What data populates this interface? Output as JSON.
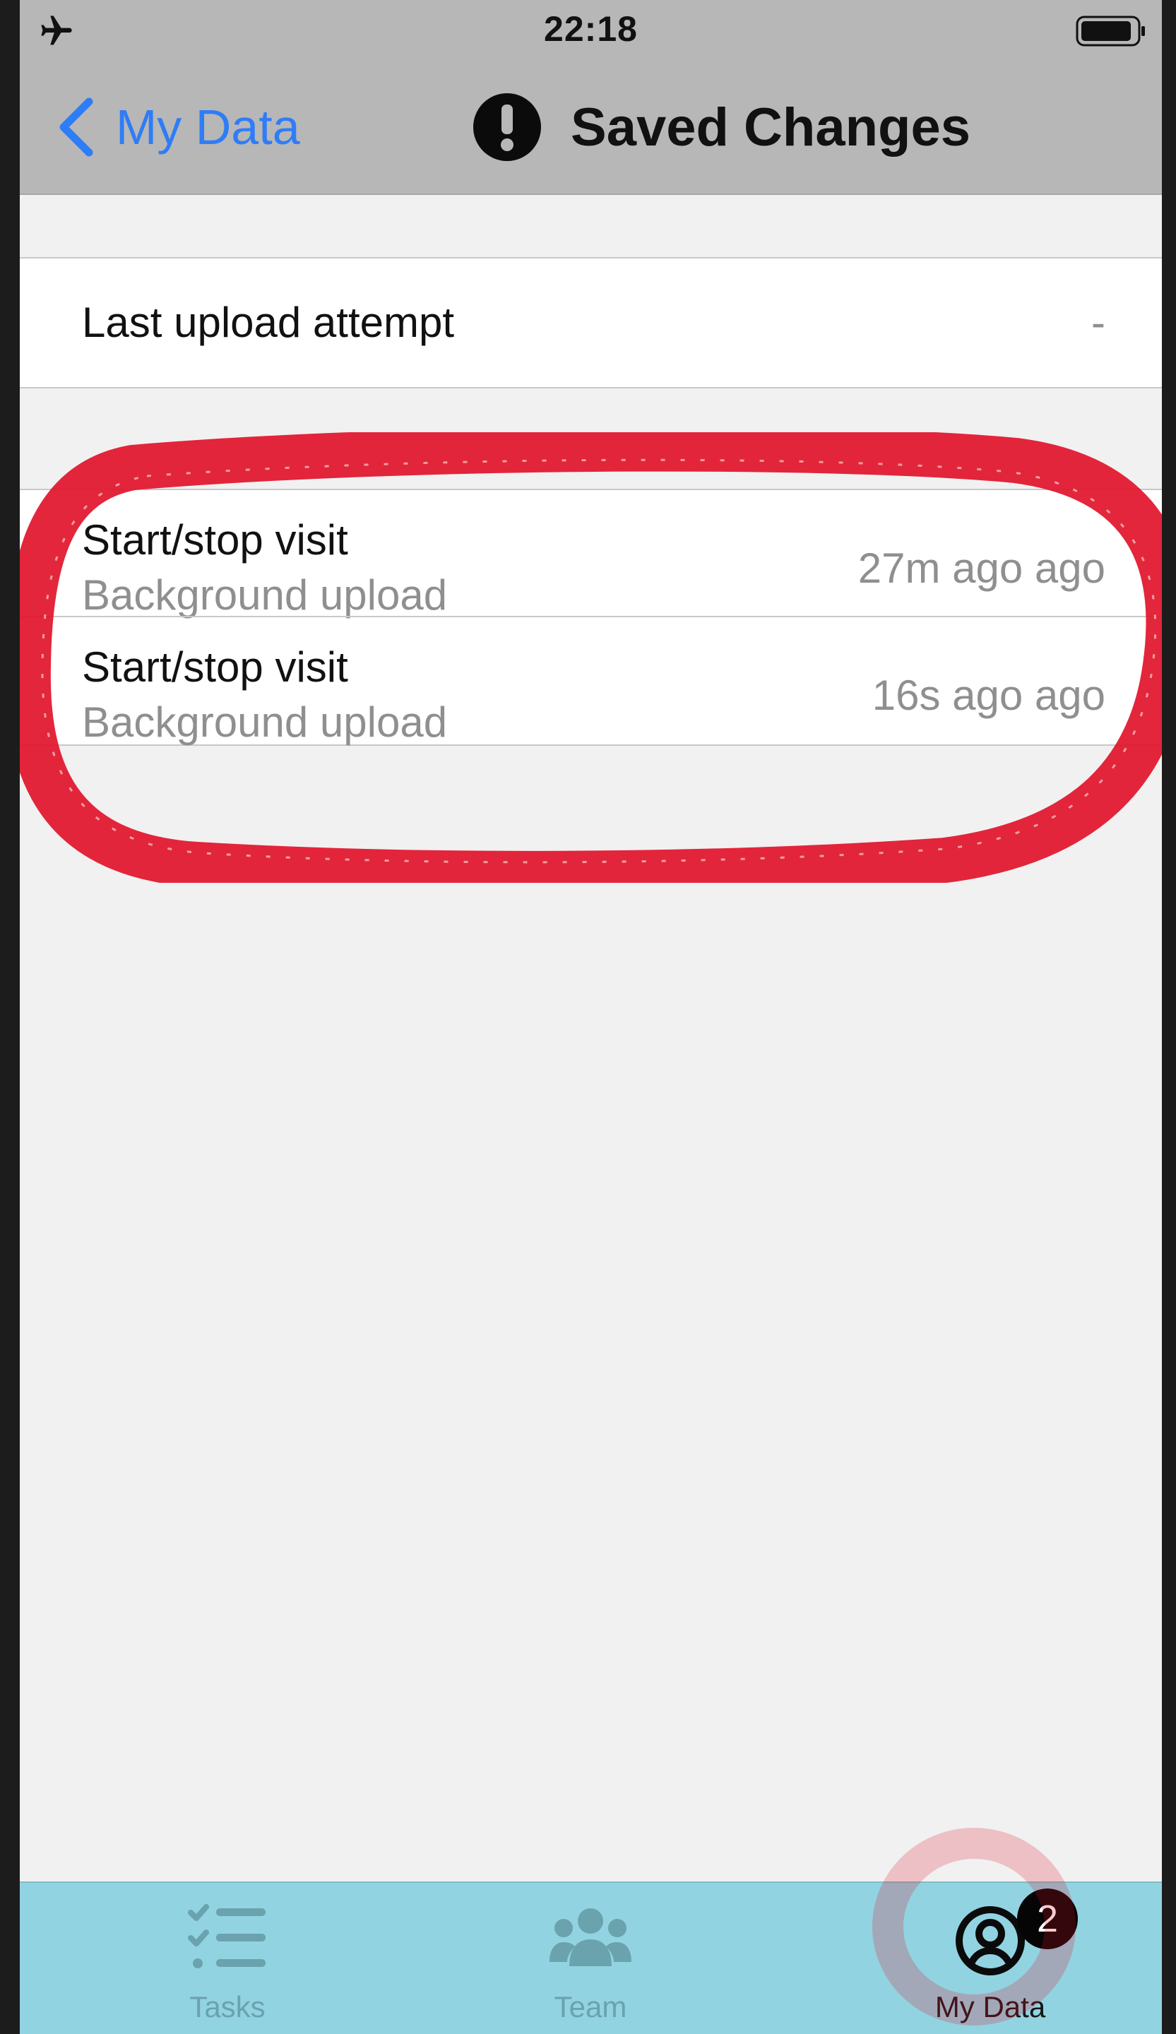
{
  "status_bar": {
    "time": "22:18"
  },
  "nav": {
    "back_label": "My Data",
    "title": "Saved Changes"
  },
  "upload_section": {
    "label": "Last upload attempt",
    "value": "-"
  },
  "changes": [
    {
      "title": "Start/stop visit",
      "subtitle": "Background upload",
      "time": "27m ago ago"
    },
    {
      "title": "Start/stop visit",
      "subtitle": "Background upload",
      "time": "16s ago ago"
    }
  ],
  "tab_bar": {
    "tabs": [
      {
        "label": "Tasks",
        "icon": "tasks-icon"
      },
      {
        "label": "Team",
        "icon": "team-icon"
      },
      {
        "label": "My Data",
        "icon": "user-icon",
        "badge": "2",
        "active": true
      }
    ]
  },
  "colors": {
    "nav_background": "#b7b7b7",
    "link_blue": "#2f7df6",
    "tab_bar_background": "#92d3e1",
    "annotation_red": "#e1142a"
  }
}
